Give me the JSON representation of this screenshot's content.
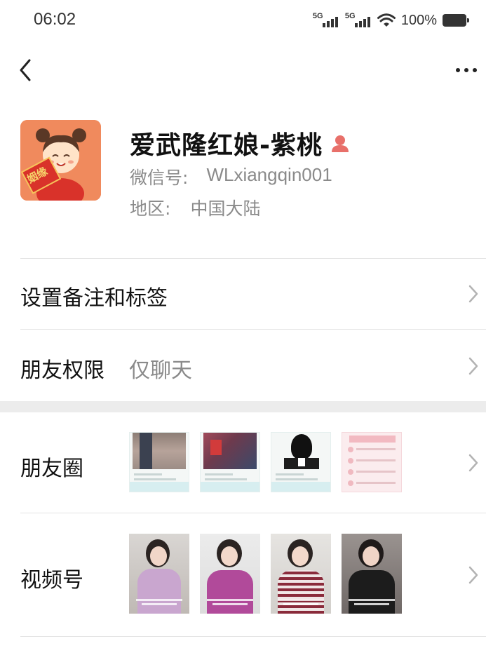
{
  "status_bar": {
    "time": "06:02",
    "network1": "5G",
    "network2": "5G",
    "battery": "100%"
  },
  "nav": {
    "back_icon": "chevron-left-icon",
    "more_icon": "more-dots-icon"
  },
  "profile": {
    "name": "爱武隆红娘-紫桃",
    "wechat_label": "微信号:",
    "wechat_id": "WLxiangqin001",
    "region_label": "地区:",
    "region": "中国大陆",
    "avatar_text": "姻缘",
    "badge_color": "#e8706a"
  },
  "rows": {
    "remark": {
      "label": "设置备注和标签"
    },
    "permission": {
      "label": "朋友权限",
      "value": "仅聊天"
    },
    "moments": {
      "label": "朋友圈"
    },
    "channels": {
      "label": "视频号"
    }
  },
  "colors": {
    "accent_red": "#d9322a",
    "avatar_bg": "#f08a5d",
    "divider": "#e2e2e2",
    "secondary_text": "#8a8a8a"
  }
}
